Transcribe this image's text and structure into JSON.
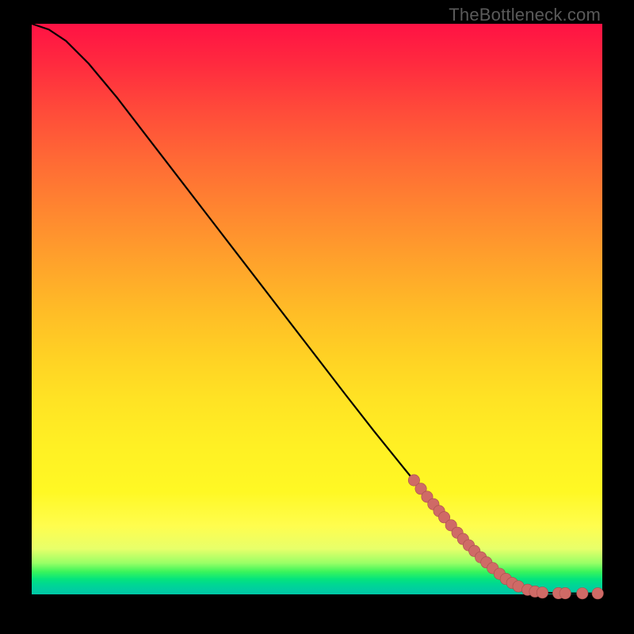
{
  "watermark": "TheBottleneck.com",
  "chart_data": {
    "type": "line",
    "title": "",
    "xlabel": "",
    "ylabel": "",
    "xlim": [
      0,
      100
    ],
    "ylim": [
      0,
      100
    ],
    "grid": false,
    "legend": false,
    "background": "rainbow-gradient",
    "series": [
      {
        "name": "curve",
        "x": [
          0,
          3,
          6,
          10,
          15,
          20,
          25,
          30,
          35,
          40,
          45,
          50,
          55,
          60,
          65,
          70,
          73,
          76,
          80,
          84,
          86,
          88,
          90,
          93,
          95,
          97,
          100
        ],
        "y": [
          100,
          99,
          97,
          93,
          87,
          80.5,
          74,
          67.5,
          61,
          54.5,
          48,
          41.5,
          35,
          28.6,
          22.4,
          16.3,
          12.7,
          9.3,
          5.3,
          2.1,
          1.1,
          0.55,
          0.3,
          0.2,
          0.18,
          0.17,
          0.17
        ]
      }
    ],
    "markers": {
      "name": "dots",
      "color": "#cf6a66",
      "points": [
        {
          "x": 67.0,
          "y": 20.0
        },
        {
          "x": 68.2,
          "y": 18.5
        },
        {
          "x": 69.3,
          "y": 17.1
        },
        {
          "x": 70.4,
          "y": 15.8
        },
        {
          "x": 71.4,
          "y": 14.6
        },
        {
          "x": 72.3,
          "y": 13.5
        },
        {
          "x": 73.5,
          "y": 12.1
        },
        {
          "x": 74.6,
          "y": 10.8
        },
        {
          "x": 75.6,
          "y": 9.7
        },
        {
          "x": 76.6,
          "y": 8.6
        },
        {
          "x": 77.6,
          "y": 7.6
        },
        {
          "x": 78.7,
          "y": 6.5
        },
        {
          "x": 79.7,
          "y": 5.6
        },
        {
          "x": 80.8,
          "y": 4.6
        },
        {
          "x": 82.0,
          "y": 3.6
        },
        {
          "x": 83.1,
          "y": 2.7
        },
        {
          "x": 84.2,
          "y": 2.0
        },
        {
          "x": 85.3,
          "y": 1.4
        },
        {
          "x": 86.9,
          "y": 0.8
        },
        {
          "x": 88.2,
          "y": 0.5
        },
        {
          "x": 89.5,
          "y": 0.32
        },
        {
          "x": 92.3,
          "y": 0.2
        },
        {
          "x": 93.5,
          "y": 0.19
        },
        {
          "x": 96.5,
          "y": 0.18
        },
        {
          "x": 99.2,
          "y": 0.17
        }
      ]
    }
  }
}
